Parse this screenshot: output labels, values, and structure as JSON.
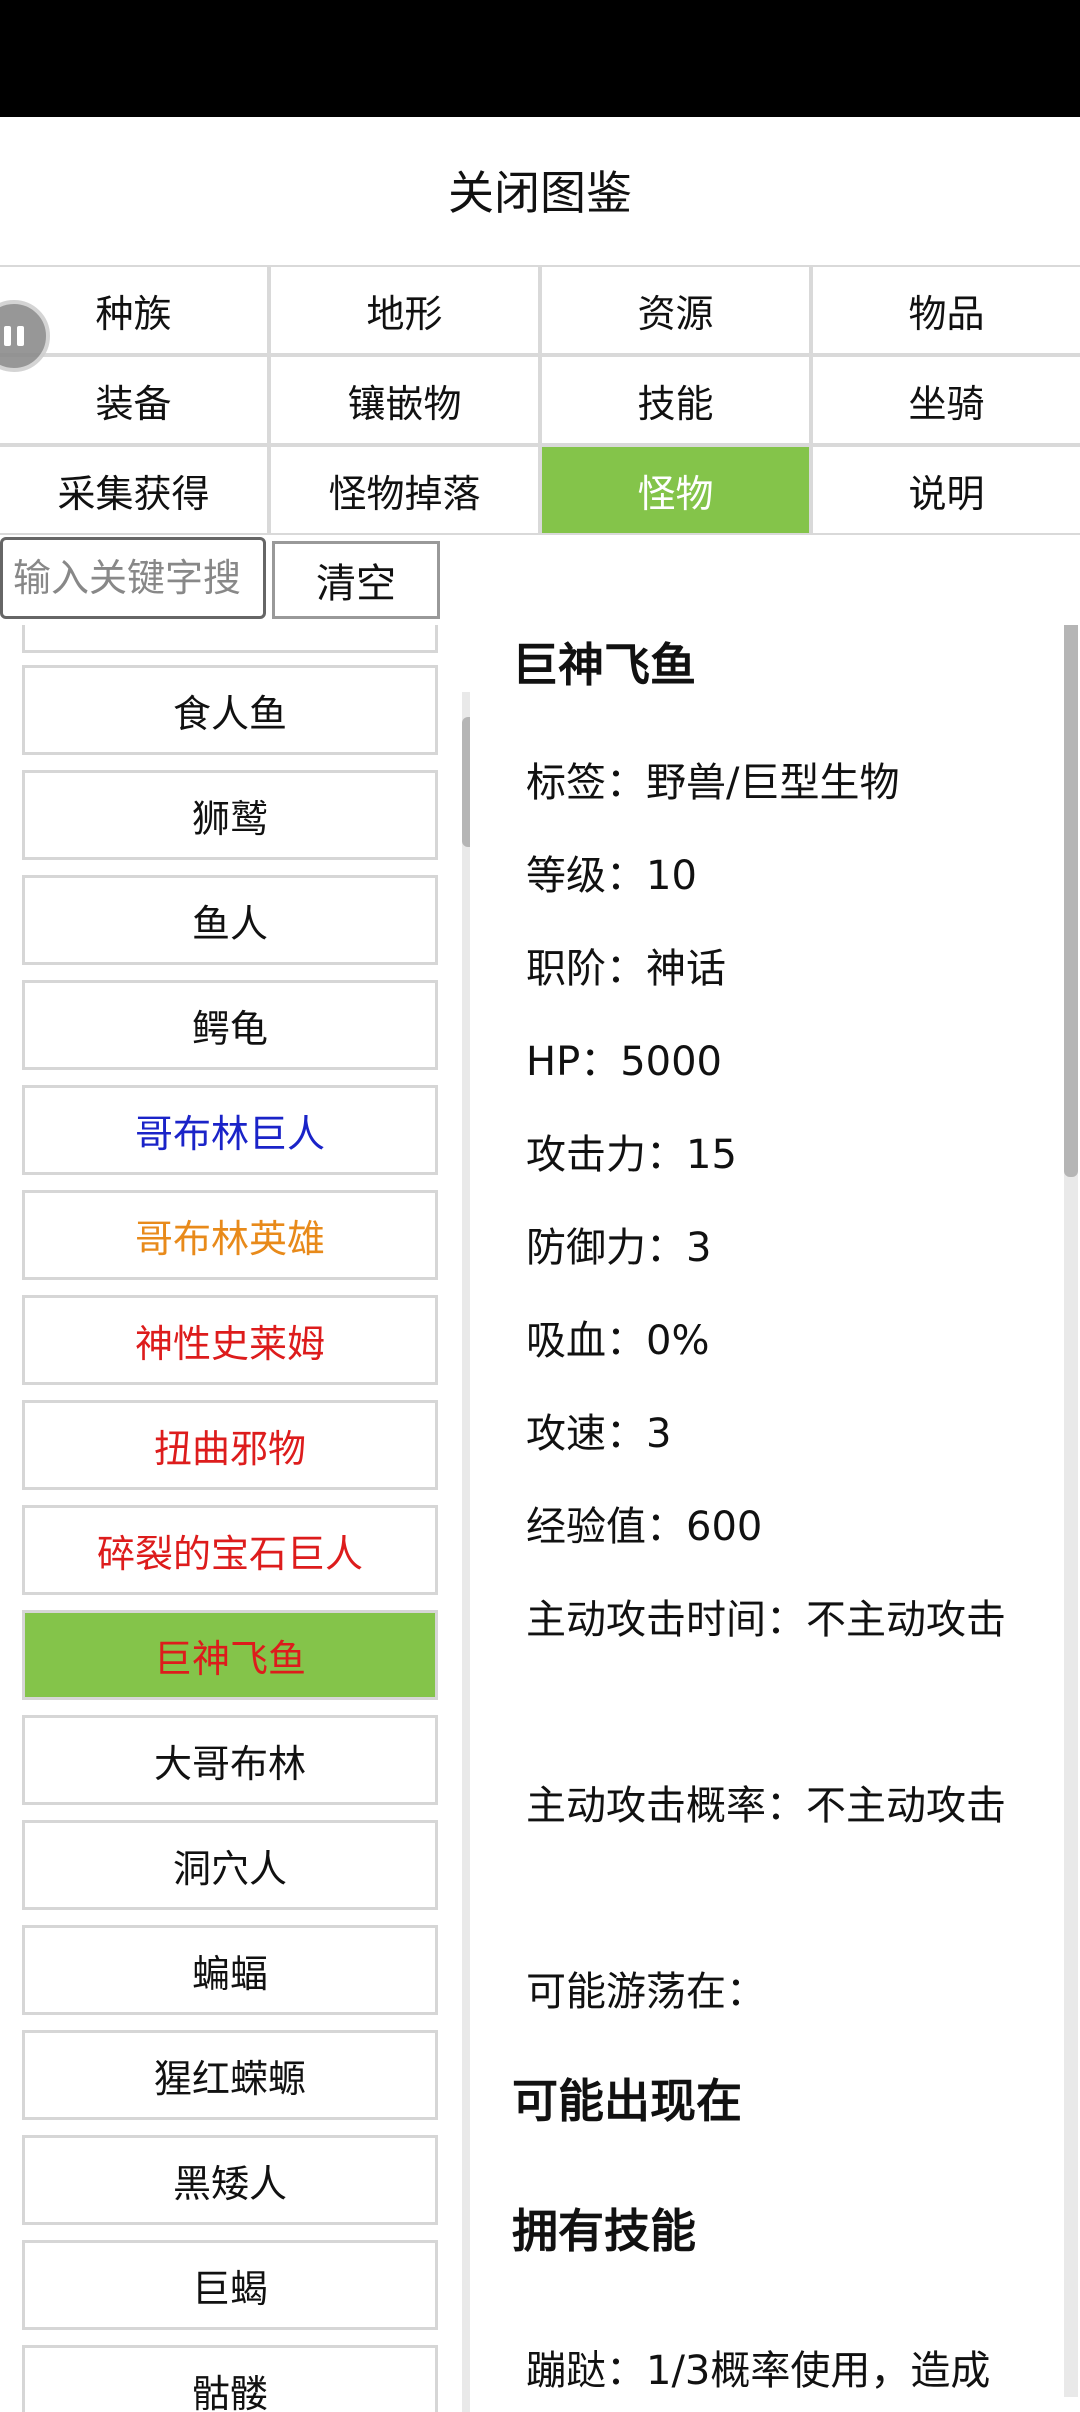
{
  "header": {
    "title": "关闭图鉴"
  },
  "categories": [
    {
      "label": "种族",
      "active": false
    },
    {
      "label": "地形",
      "active": false
    },
    {
      "label": "资源",
      "active": false
    },
    {
      "label": "物品",
      "active": false
    },
    {
      "label": "装备",
      "active": false
    },
    {
      "label": "镶嵌物",
      "active": false
    },
    {
      "label": "技能",
      "active": false
    },
    {
      "label": "坐骑",
      "active": false
    },
    {
      "label": "采集获得",
      "active": false
    },
    {
      "label": "怪物掉落",
      "active": false
    },
    {
      "label": "怪物",
      "active": true
    },
    {
      "label": "说明",
      "active": false
    }
  ],
  "search": {
    "placeholder": "输入关键字搜",
    "clear_label": "清空"
  },
  "monster_list": [
    {
      "name": "食人鱼",
      "color": "#111111",
      "selected": false
    },
    {
      "name": "狮鹫",
      "color": "#111111",
      "selected": false
    },
    {
      "name": "鱼人",
      "color": "#111111",
      "selected": false
    },
    {
      "name": "鳄龟",
      "color": "#111111",
      "selected": false
    },
    {
      "name": "哥布林巨人",
      "color": "#1a23c8",
      "selected": false
    },
    {
      "name": "哥布林英雄",
      "color": "#e88a1a",
      "selected": false
    },
    {
      "name": "神性史莱姆",
      "color": "#dd1c1c",
      "selected": false
    },
    {
      "name": "扭曲邪物",
      "color": "#dd1c1c",
      "selected": false
    },
    {
      "name": "碎裂的宝石巨人",
      "color": "#dd1c1c",
      "selected": false
    },
    {
      "name": "巨神飞鱼",
      "color": "#dd1c1c",
      "selected": true
    },
    {
      "name": "大哥布林",
      "color": "#111111",
      "selected": false
    },
    {
      "name": "洞穴人",
      "color": "#111111",
      "selected": false
    },
    {
      "name": "蝙蝠",
      "color": "#111111",
      "selected": false
    },
    {
      "name": "猩红蝾螈",
      "color": "#111111",
      "selected": false
    },
    {
      "name": "黑矮人",
      "color": "#111111",
      "selected": false
    },
    {
      "name": "巨蝎",
      "color": "#111111",
      "selected": false
    },
    {
      "name": "骷髅",
      "color": "#111111",
      "selected": false
    }
  ],
  "detail": {
    "name": "巨神飞鱼",
    "stats": [
      "标签：野兽/巨型生物",
      "等级：10",
      "职阶：神话",
      "HP：5000",
      "攻击力：15",
      "防御力：3",
      "吸血：0%",
      "攻速：3",
      "经验值：600",
      "主动攻击时间：不主动攻击",
      "主动攻击概率：不主动攻击",
      "可能游荡在："
    ],
    "section_appear": "可能出现在",
    "section_skills": "拥有技能",
    "skill_line": "蹦跶：1/3概率使用，造成"
  },
  "colors": {
    "accent": "#84c44a"
  }
}
